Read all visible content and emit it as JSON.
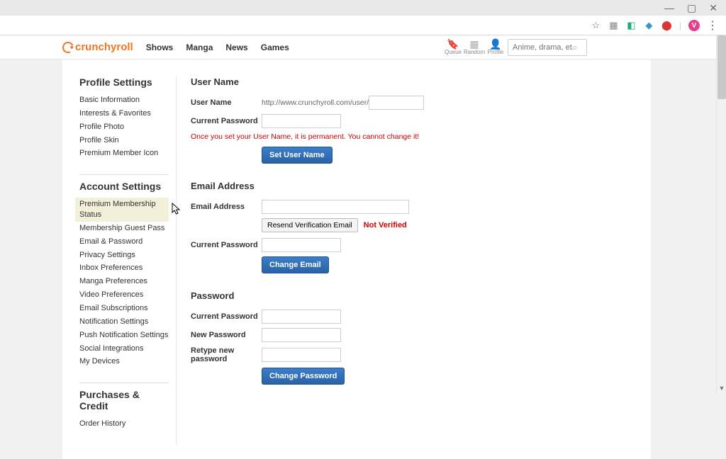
{
  "browser": {
    "window_min_icon": "—",
    "window_max_icon": "▢",
    "window_close_icon": "✕",
    "star_icon": "☆",
    "ext1_icon": "▦",
    "ext2_icon": "◧",
    "ext3_icon": "◆",
    "ext4_icon": "⬤",
    "avatar_letter": "V",
    "menu_icon": "⋮"
  },
  "header": {
    "logo": "crunchyroll",
    "nav": [
      "Shows",
      "Manga",
      "News",
      "Games"
    ],
    "quick": [
      {
        "icon": "🔖",
        "label": "Queue"
      },
      {
        "icon": "▦",
        "label": "Random"
      },
      {
        "icon": "👤",
        "label": "Profile"
      }
    ],
    "search_placeholder": "Anime, drama, etc."
  },
  "sidebar": [
    {
      "title": "Profile Settings",
      "items": [
        "Basic Information",
        "Interests & Favorites",
        "Profile Photo",
        "Profile Skin",
        "Premium Member Icon"
      ],
      "selected_index": -1
    },
    {
      "title": "Account Settings",
      "items": [
        "Premium Membership Status",
        "Membership Guest Pass",
        "Email & Password",
        "Privacy Settings",
        "Inbox Preferences",
        "Manga Preferences",
        "Video Preferences",
        "Email Subscriptions",
        "Notification Settings",
        "Push Notification Settings",
        "Social Integrations",
        "My Devices"
      ],
      "selected_index": 0
    },
    {
      "title": "Purchases & Credit",
      "items": [
        "Order History"
      ],
      "selected_index": -1
    }
  ],
  "sections": {
    "username": {
      "title": "User Name",
      "label_user": "User Name",
      "label_pass": "Current Password",
      "url_prefix": "http://www.crunchyroll.com/user/",
      "warning": "Once you set your User Name, it is permanent. You cannot change it!",
      "button": "Set User Name"
    },
    "email": {
      "title": "Email Address",
      "label_email": "Email Address",
      "resend_btn": "Resend Verification Email",
      "status": "Not Verified",
      "label_pass": "Current Password",
      "button": "Change Email"
    },
    "password": {
      "title": "Password",
      "label_current": "Current Password",
      "label_new": "New Password",
      "label_retype": "Retype new password",
      "button": "Change Password"
    }
  }
}
